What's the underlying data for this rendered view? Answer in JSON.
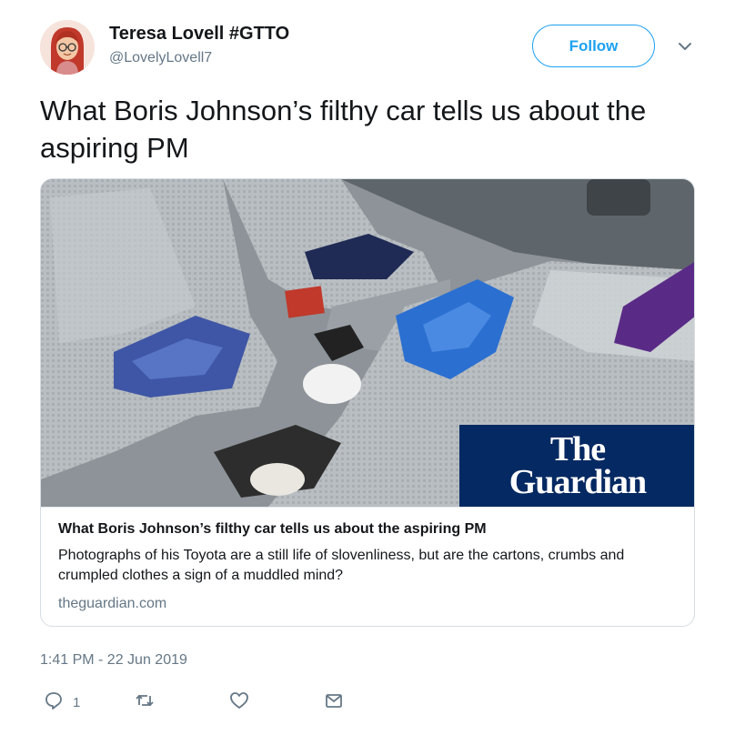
{
  "user": {
    "name": "Teresa Lovell #GTTO",
    "handle": "@LovelyLovell7",
    "follow_label": "Follow"
  },
  "tweet": {
    "text": "What Boris Johnson’s filthy car tells us about the aspiring PM",
    "timestamp": "1:41 PM - 22 Jun 2019"
  },
  "card": {
    "title": "What Boris Johnson’s filthy car tells us about the aspiring PM",
    "description": "Photographs of his Toyota are a still life of slovenliness, but are the cartons, crumbs and crumpled clothes a sign of a muddled mind?",
    "domain": "theguardian.com",
    "logo_line1": "The",
    "logo_line2": "Guardian"
  },
  "actions": {
    "reply_count": "1",
    "icons": [
      "reply-icon",
      "retweet-icon",
      "like-icon",
      "message-icon"
    ]
  },
  "colors": {
    "accent": "#1da1f2",
    "secondary_text": "#657786",
    "guardian_navy": "#052962"
  }
}
